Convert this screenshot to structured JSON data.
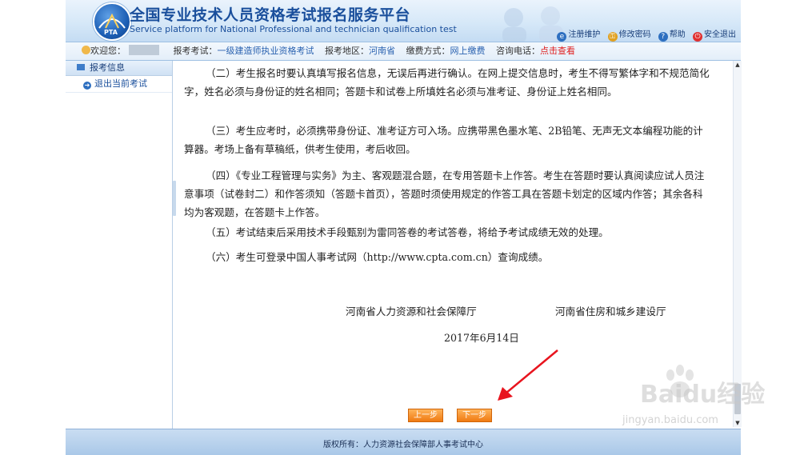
{
  "header": {
    "title_cn": "全国专业技术人员资格考试报名服务平台",
    "title_en": "Service platform for National Professional and technician qualification test",
    "links": [
      {
        "label": "注册维护",
        "icon": "register-icon",
        "color": "#2d6fc0"
      },
      {
        "label": "修改密码",
        "icon": "key-icon",
        "color": "#e0a020"
      },
      {
        "label": "帮助",
        "icon": "help-icon",
        "color": "#2d6fc0"
      },
      {
        "label": "安全退出",
        "icon": "power-icon",
        "color": "#e03030"
      }
    ]
  },
  "infobar": {
    "welcome": "欢迎您：",
    "exam_label": "报考考试：",
    "exam_value": "一级建造师执业资格考试",
    "region_label": "报考地区：",
    "region_value": "河南省",
    "payment_label": "缴费方式：",
    "payment_value": "网上缴费",
    "phone_label": "咨询电话：",
    "phone_value": "点击查看"
  },
  "sidebar": {
    "header": "报考信息",
    "items": [
      {
        "label": "退出当前考试",
        "icon": "arrow-right-icon"
      }
    ]
  },
  "content": {
    "paragraphs": [
      "（二）考生报名时要认真填写报名信息，无误后再进行确认。在网上提交信息时，考生不得写繁体字和不规范简化字，姓名必须与身份证的姓名相同；答题卡和试卷上所填姓名必须与准考证、身份证上姓名相同。",
      "（三）考生应考时，必须携带身份证、准考证方可入场。应携带黑色墨水笔、2B铅笔、无声无文本编程功能的计算器。考场上备有草稿纸，供考生使用，考后收回。",
      "（四）《专业工程管理与实务》为主、客观题混合题，在专用答题卡上作答。考生在答题时要认真阅读应试人员注意事项（试卷封二）和作答须知（答题卡首页），答题时须使用规定的作答工具在答题卡划定的区域内作答；其余各科均为客观题，在答题卡上作答。",
      "（五）考试结束后采用技术手段甄别为雷同答卷的考试答卷，将给予考试成绩无效的处理。",
      "（六）考生可登录中国人事考试网（http://www.cpta.com.cn）查询成绩。"
    ],
    "signatories": [
      "河南省人力资源和社会保障厅",
      "河南省住房和城乡建设厅"
    ],
    "date": "2017年6月14日"
  },
  "buttons": {
    "prev": "上一步",
    "next": "下一步"
  },
  "footer": {
    "copyright": "版权所有：人力资源社会保障部人事考试中心"
  },
  "watermark": {
    "brand": "Baidu经验",
    "url": "jingyan.baidu.com"
  },
  "colors": {
    "accent": "#1a4f9c",
    "link": "#2a62b0",
    "alert": "#e02020",
    "button": "#f07a12",
    "annotation_arrow": "#e8141e"
  }
}
